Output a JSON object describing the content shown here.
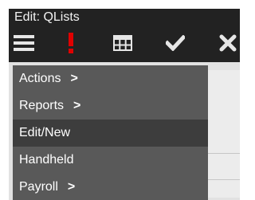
{
  "window": {
    "title": "Edit: QLists"
  },
  "toolbar": {
    "icons": [
      "menu-icon",
      "alert-icon",
      "grid-icon",
      "check-icon",
      "close-icon"
    ],
    "alert_color": "#e00000",
    "icon_color": "#e6e6e6"
  },
  "menu": {
    "items": [
      {
        "label": "Actions",
        "arrow": ">"
      },
      {
        "label": "Reports",
        "arrow": ">"
      },
      {
        "label": "Edit/New",
        "arrow": "",
        "selected": true
      },
      {
        "label": "Handheld",
        "arrow": ""
      },
      {
        "label": "Payroll",
        "arrow": ">"
      }
    ]
  },
  "colors": {
    "titlebar": "#222222",
    "menu_bg": "#595959",
    "menu_selected": "#3d3d3d",
    "content_bg": "#e2e2e2"
  }
}
